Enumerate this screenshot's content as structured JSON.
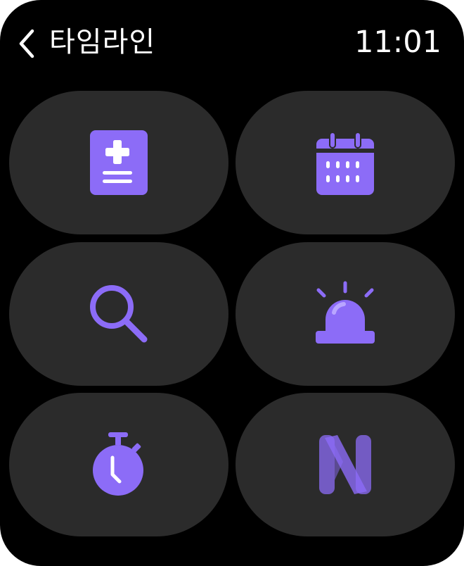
{
  "header": {
    "title": "타임라인",
    "time": "11:01"
  },
  "colors": {
    "background": "#000000",
    "tile": "#2b2b2b",
    "accent": "#8c6cf7",
    "text": "#ffffff"
  },
  "tiles": [
    {
      "icon": "health-report-icon"
    },
    {
      "icon": "calendar-icon"
    },
    {
      "icon": "search-icon"
    },
    {
      "icon": "alarm-siren-icon"
    },
    {
      "icon": "stopwatch-icon"
    },
    {
      "icon": "n-logo-icon"
    }
  ]
}
